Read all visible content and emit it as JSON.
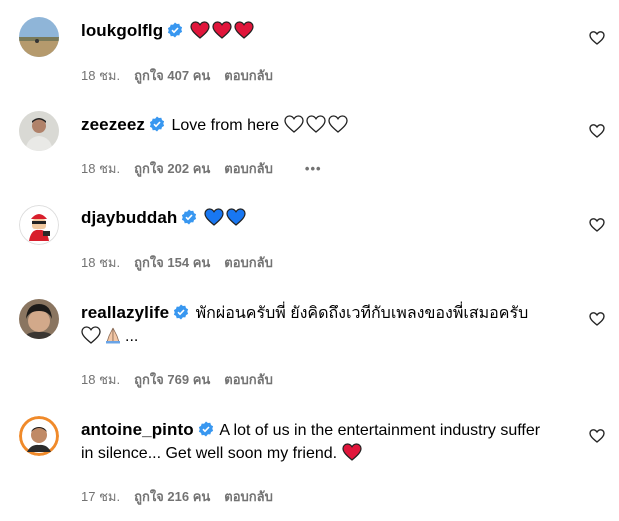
{
  "comments": [
    {
      "username": "loukgolflg",
      "text": "",
      "emojis": [
        "red-heart",
        "red-heart",
        "red-heart"
      ],
      "time": "18 ชม.",
      "likes": "ถูกใจ 407 คน",
      "reply": "ตอบกลับ",
      "avatar": "landscape"
    },
    {
      "username": "zeezeez",
      "text": "Love from here",
      "emojis": [
        "outline-heart",
        "outline-heart",
        "outline-heart"
      ],
      "time": "18 ชม.",
      "likes": "ถูกใจ 202 คน",
      "reply": "ตอบกลับ",
      "more": "•••",
      "avatar": "person-grey"
    },
    {
      "username": "djaybuddah",
      "text": "",
      "emojis": [
        "blue-heart",
        "blue-heart"
      ],
      "time": "18 ชม.",
      "likes": "ถูกใจ 154 คน",
      "reply": "ตอบกลับ",
      "avatar": "cartoon-red"
    },
    {
      "username": "reallazylife",
      "text": "พักผ่อนครับพี่ ยังคิดถึงเวทีกับเพลงของพี่เสมอครับ",
      "trailing": "...",
      "emojis": [
        "outline-heart",
        "praying-hands"
      ],
      "time": "18 ชม.",
      "likes": "ถูกใจ 769 คน",
      "reply": "ตอบกลับ",
      "avatar": "person-dark"
    },
    {
      "username": "antoine_pinto",
      "text": "A lot of us in the entertainment industry suffer in silence... Get well soon my friend.",
      "emojis": [
        "red-heart"
      ],
      "time": "17 ชม.",
      "likes": "ถูกใจ 216 คน",
      "reply": "ตอบกลับ",
      "avatar": "person-orange"
    }
  ],
  "colors": {
    "verified": "#3897f0",
    "meta": "#737373",
    "red_heart": "#e0163b",
    "blue_heart": "#1877f2"
  },
  "icons": {
    "like": "heart-outline-icon",
    "verified": "verified-badge-icon"
  }
}
